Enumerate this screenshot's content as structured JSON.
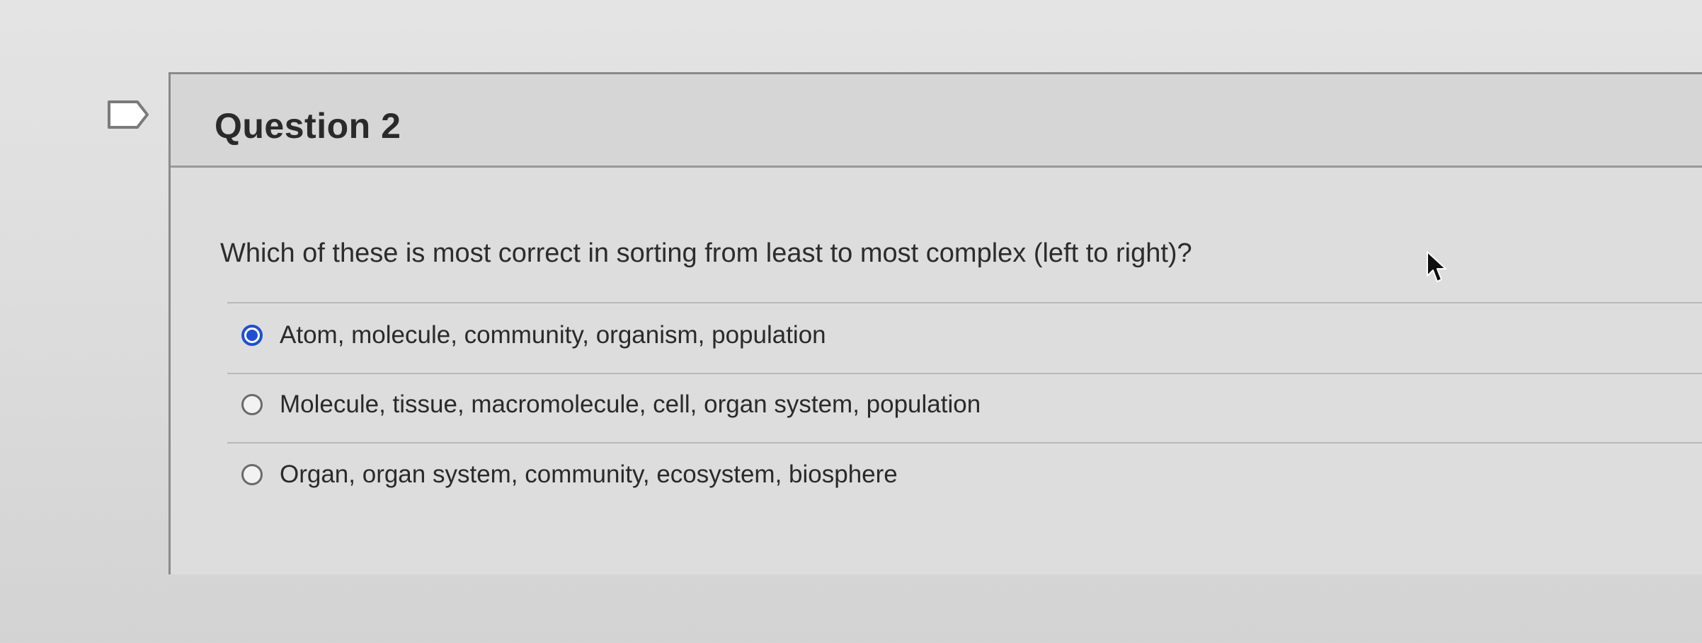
{
  "question": {
    "title": "Question 2",
    "prompt": "Which of these is most correct in sorting from least to most complex (left to right)?",
    "answers": [
      {
        "label": "Atom, molecule, community, organism, population",
        "selected": true
      },
      {
        "label": "Molecule, tissue, macromolecule, cell, organ system, population",
        "selected": false
      },
      {
        "label": "Organ, organ system, community, ecosystem, biosphere",
        "selected": false
      }
    ]
  },
  "icons": {
    "flag": "bookmark-flag-icon",
    "cursor": "mouse-pointer-icon",
    "radio_selected": "radio-selected-icon",
    "radio_unselected": "radio-unselected-icon"
  },
  "colors": {
    "accent": "#1f4fd1",
    "text": "#2a2a2a",
    "border": "#8a8a8a"
  }
}
